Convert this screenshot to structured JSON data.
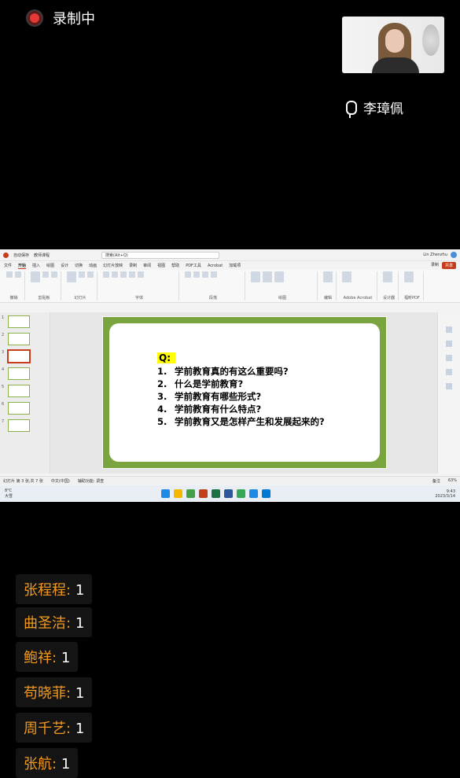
{
  "recording": {
    "label": "录制中",
    "dot_color": "#e53935"
  },
  "camera": {
    "name": "李璋佩"
  },
  "ppt": {
    "title_left": "自动保存",
    "doc_name": "教师课程",
    "search": "搜索(Alt+Q)",
    "user": "Lin Zhenzhu",
    "tabs": [
      "文件",
      "开始",
      "插入",
      "绘图",
      "设计",
      "切换",
      "动画",
      "幻灯片放映",
      "录制",
      "审阅",
      "视图",
      "帮助",
      "PDF工具",
      "Acrobat",
      "加载项"
    ],
    "record_label": "录制",
    "share_label": "共享",
    "ribbon_groups": [
      "撤销",
      "剪贴板",
      "幻灯片",
      "字体",
      "段落",
      "绘图",
      "编辑",
      "Adobe Acrobat",
      "设计器",
      "福昕PDF"
    ],
    "slides": [
      "1",
      "2",
      "3",
      "4",
      "5",
      "6",
      "7"
    ],
    "selected_slide": 3,
    "slide_q": "Q:",
    "questions": [
      {
        "n": "1.",
        "t": "学前教育真的有这么重要吗?"
      },
      {
        "n": "2.",
        "t": "什么是学前教育?"
      },
      {
        "n": "3.",
        "t": "学前教育有哪些形式?"
      },
      {
        "n": "4.",
        "t": "学前教育有什么特点?"
      },
      {
        "n": "5.",
        "t": "学前教育又是怎样产生和发展起来的?"
      }
    ],
    "status_left": "幻灯片 第 3 张,共 7 张",
    "status_lang": "中文(中国)",
    "status_access": "辅助功能: 调查",
    "status_notes": "备注",
    "zoom": "63%",
    "weather": "8°C",
    "weather_desc": "大雪",
    "time": "9:43",
    "date": "2023/3/14"
  },
  "chat": [
    {
      "name": "张程程:",
      "count": "1"
    },
    {
      "name": "曲圣洁:",
      "count": "1"
    },
    {
      "name": "鲍祥:",
      "count": "1"
    },
    {
      "name": "苟晓菲:",
      "count": "1"
    },
    {
      "name": "周千艺:",
      "count": "1"
    },
    {
      "name": "张航:",
      "count": "1"
    }
  ]
}
